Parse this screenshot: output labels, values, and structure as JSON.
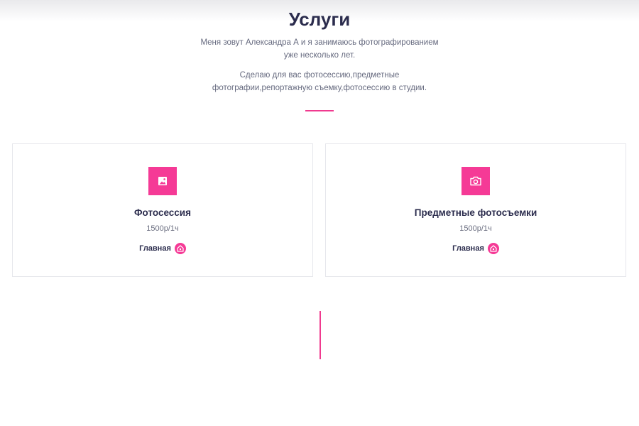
{
  "services": {
    "title": "Услуги",
    "intro_1": "Меня зовут Александра А и я занимаюсь фотографированием уже несколько лет.",
    "intro_2": "Сделаю для вас фотосессию,предметные фотографии,репортажную съемку,фотосессию в студии.",
    "accent_color": "#f53a96",
    "cards": [
      {
        "icon": "image-icon",
        "title": "Фотосессия",
        "price": "1500р/1ч",
        "link_label": "Главная",
        "link_icon": "home-icon"
      },
      {
        "icon": "camera-icon",
        "title": "Предметные фотосъемки",
        "price": "1500р/1ч",
        "link_label": "Главная",
        "link_icon": "home-icon"
      }
    ]
  }
}
